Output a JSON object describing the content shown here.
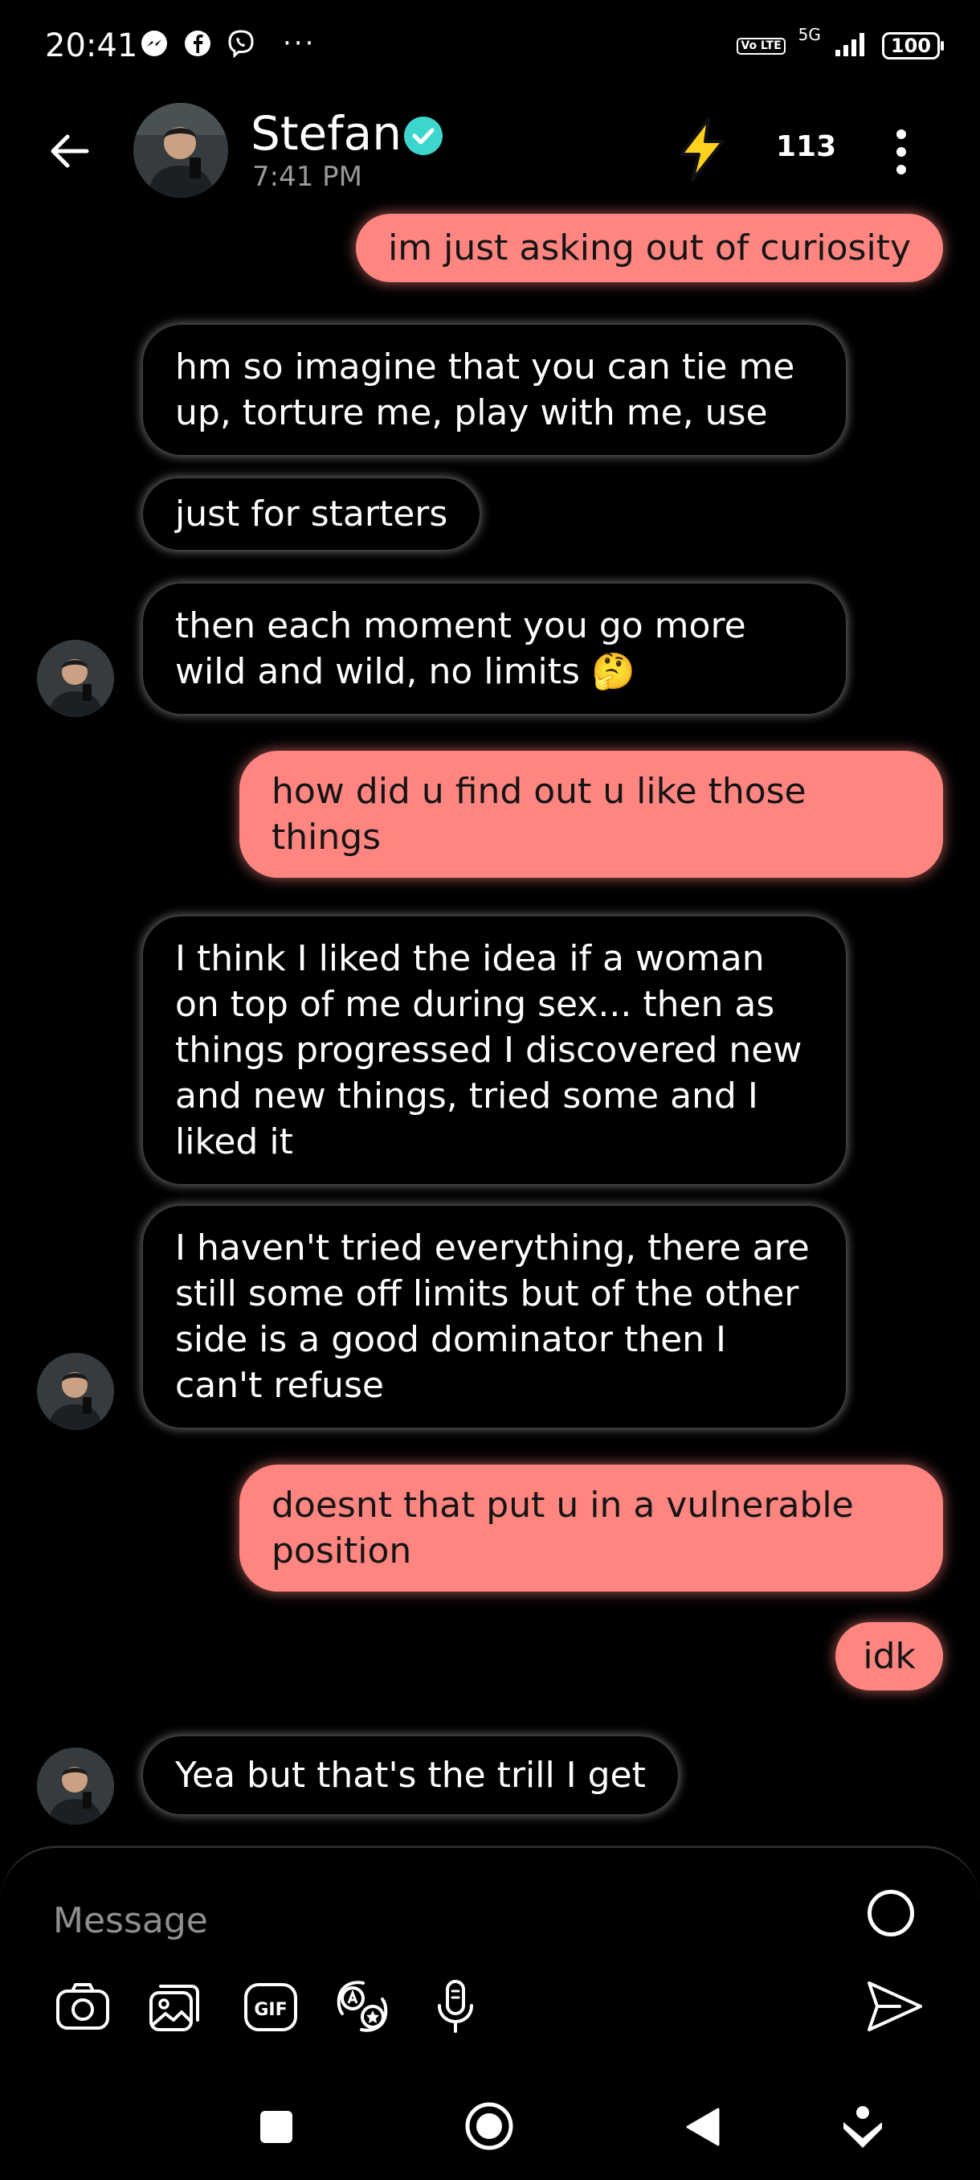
{
  "status_bar": {
    "time": "20:41",
    "network": "5G",
    "volte": "Vo LTE",
    "battery": "100",
    "more": "···",
    "icons": [
      "messenger-icon",
      "facebook-icon",
      "viber-icon"
    ]
  },
  "header": {
    "title": "Stefan",
    "subtitle": "7:41 PM",
    "count": "113",
    "verified_color": "#3dd6cf",
    "bolt_color": "#ffd21f"
  },
  "messages": [
    {
      "from": "me",
      "text": "im just asking out of curiosity"
    },
    {
      "from": "them",
      "text": "hm so imagine that you can tie me up, torture me, play with me, use"
    },
    {
      "from": "them",
      "text": "just for starters"
    },
    {
      "from": "them",
      "text": "then each moment you go more wild and wild, no limits 🤔"
    },
    {
      "from": "me",
      "text": "how did u find out u like those things"
    },
    {
      "from": "them",
      "text": "I think I liked the idea if a woman on top of me during sex... then as things progressed I discovered new and new things, tried some and I liked it"
    },
    {
      "from": "them",
      "text": "I haven't tried everything, there are still some off limits but of the other side is a good dominator then I can't refuse"
    },
    {
      "from": "me",
      "text": "doesnt that put u in a vulnerable position"
    },
    {
      "from": "me",
      "text": "idk"
    },
    {
      "from": "them",
      "text": "Yea but that's the trill I get"
    }
  ],
  "composer": {
    "placeholder": "Message",
    "tools": [
      "camera-icon",
      "gallery-icon",
      "gif-icon",
      "sticker-icon",
      "microphone-icon"
    ],
    "gif_label": "GIF"
  },
  "colors": {
    "sent_bubble": "#ff8580",
    "received_bubble": "#000000",
    "background": "#000000"
  }
}
